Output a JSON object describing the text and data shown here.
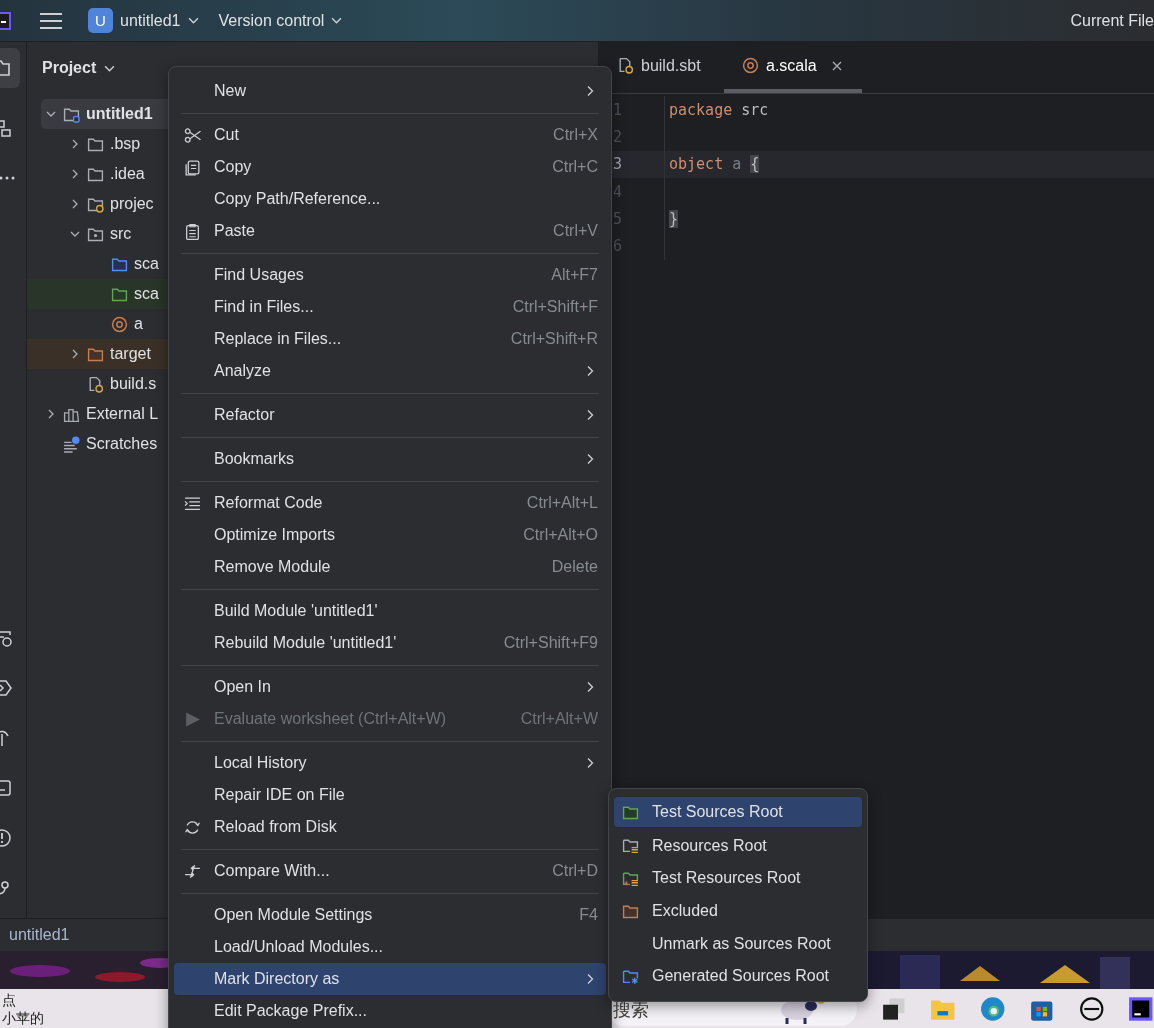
{
  "topbar": {
    "project_badge": "U",
    "project": "untitled1",
    "vcs": "Version control",
    "run_config": "Current File"
  },
  "project_panel": {
    "title": "Project",
    "tree": [
      {
        "label": "untitled1",
        "kind": "module",
        "expanded": true,
        "selected": true,
        "children": [
          {
            "label": ".bsp",
            "kind": "folder",
            "expanded": false,
            "selected": false
          },
          {
            "label": ".idea",
            "kind": "folder",
            "expanded": false,
            "selected": false
          },
          {
            "label": "projec",
            "kind": "sbt_folder",
            "expanded": false,
            "selected": false
          },
          {
            "label": "src",
            "kind": "package",
            "expanded": true,
            "selected": false,
            "children": [
              {
                "label": "sca",
                "kind": "source",
                "selected": false
              },
              {
                "label": "sca",
                "kind": "test",
                "selected": false
              },
              {
                "label": "a",
                "kind": "scala",
                "selected": false
              }
            ]
          },
          {
            "label": "target",
            "kind": "excluded",
            "expanded": false,
            "selected": false
          },
          {
            "label": "build.s",
            "kind": "sbt",
            "selected": false
          }
        ]
      },
      {
        "label": "External L",
        "kind": "library",
        "expanded": false,
        "selected": false
      },
      {
        "label": "Scratches",
        "kind": "scratch",
        "selected": false
      }
    ]
  },
  "editor": {
    "tabs": [
      {
        "label": "build.sbt",
        "kind": "sbt",
        "selected": false,
        "closable": false
      },
      {
        "label": "a.scala",
        "kind": "scala",
        "selected": true,
        "closable": true
      }
    ],
    "lines": [
      {
        "number": "1",
        "current": false,
        "tokens": [
          {
            "text": "package",
            "kind": "keyword"
          },
          {
            "text": "src",
            "kind": "ident"
          }
        ]
      },
      {
        "number": "2",
        "current": false
      },
      {
        "number": "3",
        "current": true,
        "tokens": [
          {
            "text": "object",
            "kind": "keyword"
          },
          {
            "text": "a",
            "kind": "unused"
          },
          {
            "text": "{",
            "kind": "brace"
          }
        ]
      },
      {
        "number": "4",
        "current": false
      },
      {
        "number": "5",
        "current": false,
        "tokens": [
          {
            "text": "}",
            "kind": "brace"
          }
        ]
      },
      {
        "number": "6",
        "current": false
      }
    ]
  },
  "status_bar": {
    "path": "untitled1"
  },
  "context_menu": [
    {
      "kind": "plain",
      "label": "New",
      "submenu": true,
      "disabled": false,
      "selected": false
    },
    {
      "kind": "separator"
    },
    {
      "kind": "cut",
      "label": "Cut",
      "shortcut": "Ctrl+X",
      "submenu": false,
      "disabled": false,
      "selected": false
    },
    {
      "kind": "copy",
      "label": "Copy",
      "shortcut": "Ctrl+C",
      "submenu": false,
      "disabled": false,
      "selected": false
    },
    {
      "kind": "plain",
      "label": "Copy Path/Reference...",
      "submenu": false,
      "disabled": false,
      "selected": false
    },
    {
      "kind": "paste",
      "label": "Paste",
      "shortcut": "Ctrl+V",
      "submenu": false,
      "disabled": false,
      "selected": false
    },
    {
      "kind": "separator"
    },
    {
      "kind": "plain",
      "label": "Find Usages",
      "shortcut": "Alt+F7",
      "submenu": false,
      "disabled": false,
      "selected": false
    },
    {
      "kind": "plain",
      "label": "Find in Files...",
      "shortcut": "Ctrl+Shift+F",
      "submenu": false,
      "disabled": false,
      "selected": false
    },
    {
      "kind": "plain",
      "label": "Replace in Files...",
      "shortcut": "Ctrl+Shift+R",
      "submenu": false,
      "disabled": false,
      "selected": false
    },
    {
      "kind": "plain",
      "label": "Analyze",
      "submenu": true,
      "disabled": false,
      "selected": false
    },
    {
      "kind": "separator"
    },
    {
      "kind": "plain",
      "label": "Refactor",
      "submenu": true,
      "disabled": false,
      "selected": false
    },
    {
      "kind": "separator"
    },
    {
      "kind": "plain",
      "label": "Bookmarks",
      "submenu": true,
      "disabled": false,
      "selected": false
    },
    {
      "kind": "separator"
    },
    {
      "kind": "reformat",
      "label": "Reformat Code",
      "shortcut": "Ctrl+Alt+L",
      "submenu": false,
      "disabled": false,
      "selected": false
    },
    {
      "kind": "plain",
      "label": "Optimize Imports",
      "shortcut": "Ctrl+Alt+O",
      "submenu": false,
      "disabled": false,
      "selected": false
    },
    {
      "kind": "plain",
      "label": "Remove Module",
      "shortcut": "Delete",
      "submenu": false,
      "disabled": false,
      "selected": false
    },
    {
      "kind": "separator"
    },
    {
      "kind": "plain",
      "label": "Build Module 'untitled1'",
      "submenu": false,
      "disabled": false,
      "selected": false
    },
    {
      "kind": "plain",
      "label": "Rebuild Module 'untitled1'",
      "shortcut": "Ctrl+Shift+F9",
      "submenu": false,
      "disabled": false,
      "selected": false
    },
    {
      "kind": "separator"
    },
    {
      "kind": "plain",
      "label": "Open In",
      "submenu": true,
      "disabled": false,
      "selected": false
    },
    {
      "kind": "run",
      "label": "Evaluate worksheet (Ctrl+Alt+W)",
      "shortcut": "Ctrl+Alt+W",
      "submenu": false,
      "disabled": true,
      "selected": false
    },
    {
      "kind": "separator"
    },
    {
      "kind": "plain",
      "label": "Local History",
      "submenu": true,
      "disabled": false,
      "selected": false
    },
    {
      "kind": "plain",
      "label": "Repair IDE on File",
      "submenu": false,
      "disabled": false,
      "selected": false
    },
    {
      "kind": "reload",
      "label": "Reload from Disk",
      "submenu": false,
      "disabled": false,
      "selected": false
    },
    {
      "kind": "separator"
    },
    {
      "kind": "compare",
      "label": "Compare With...",
      "shortcut": "Ctrl+D",
      "submenu": false,
      "disabled": false,
      "selected": false
    },
    {
      "kind": "separator"
    },
    {
      "kind": "plain",
      "label": "Open Module Settings",
      "shortcut": "F4",
      "submenu": false,
      "disabled": false,
      "selected": false
    },
    {
      "kind": "plain",
      "label": "Load/Unload Modules...",
      "submenu": false,
      "disabled": false,
      "selected": false
    },
    {
      "kind": "plain",
      "label": "Mark Directory as",
      "submenu": true,
      "disabled": false,
      "selected": true
    },
    {
      "kind": "plain",
      "label": "Edit Package Prefix...",
      "submenu": false,
      "disabled": false,
      "selected": false
    }
  ],
  "submenu": [
    {
      "kind": "test",
      "label": "Test Sources Root",
      "selected": true
    },
    {
      "kind": "resources",
      "label": "Resources Root",
      "selected": false
    },
    {
      "kind": "test_resources",
      "label": "Test Resources Root",
      "selected": false
    },
    {
      "kind": "excluded",
      "label": "Excluded",
      "selected": false
    },
    {
      "kind": "none",
      "label": "Unmark as Sources Root",
      "selected": false
    },
    {
      "kind": "generated",
      "label": "Generated Sources Root",
      "selected": false
    }
  ],
  "taskbar": {
    "widget_lines": [
      "点",
      "小苹的"
    ],
    "search": {
      "placeholder": "搜索"
    }
  }
}
